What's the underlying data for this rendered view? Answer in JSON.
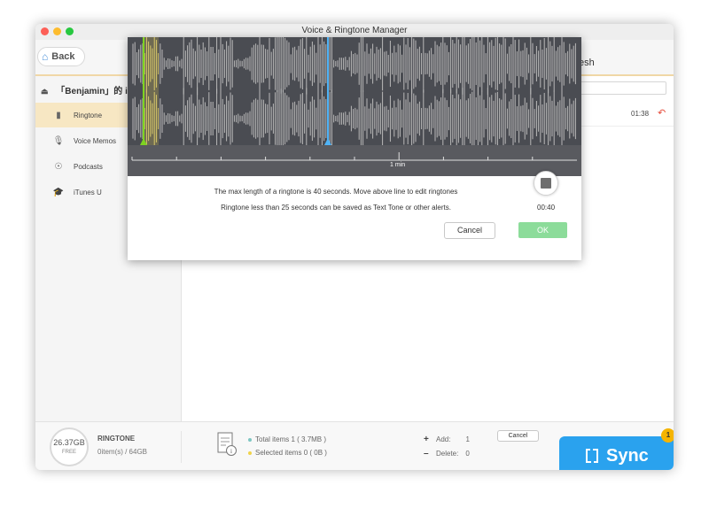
{
  "window": {
    "title": "Voice & Ringtone Manager"
  },
  "header": {
    "back_label": "Back",
    "refresh_label": "esh"
  },
  "sidebar": {
    "device_name": "「Benjamin」的 iPad",
    "items": [
      {
        "label": "Ringtone",
        "icon": "ringtone-icon",
        "active": true
      },
      {
        "label": "Voice Memos",
        "icon": "microphone-icon",
        "active": false
      },
      {
        "label": "Podcasts",
        "icon": "podcast-icon",
        "active": false
      },
      {
        "label": "iTunes U",
        "icon": "graduation-cap-icon",
        "active": false
      }
    ]
  },
  "list": {
    "duration": "01:38"
  },
  "dialog": {
    "timeline_label": "1 min",
    "message_1": "The max length of a ringtone is 40 seconds. Move above line to edit ringtones",
    "message_2": "Ringtone less than 25 seconds can be saved as Text Tone or other alerts.",
    "playback_time": "00:40",
    "cancel_label": "Cancel",
    "ok_label": "OK"
  },
  "footer": {
    "storage_free": "26.37GB",
    "storage_free_label": "FREE",
    "section_label": "RINGTONE",
    "usage": "0item(s) / 64GB",
    "total_items": "Total items 1 ( 3.7MB )",
    "selected_items": "Selected items 0 ( 0B )",
    "add_label": "Add:",
    "add_count": "1",
    "delete_label": "Delete:",
    "delete_count": "0",
    "cancel_label": "Cancel",
    "sync_label": "Sync",
    "sync_badge": "1"
  },
  "colors": {
    "accent_blue": "#2aa2ee",
    "ok_green": "#8cdc9a",
    "active_row": "#f7e7c3",
    "marker_green": "#7ed321",
    "marker_blue": "#4fb3f6",
    "badge": "#f5b400"
  }
}
